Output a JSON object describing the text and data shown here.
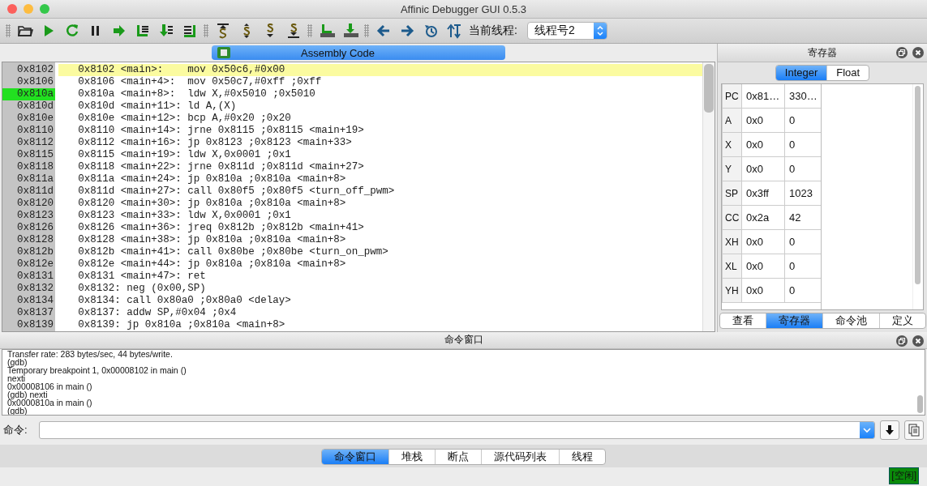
{
  "window": {
    "title": "Affinic Debugger GUI 0.5.3"
  },
  "toolbar": {
    "thread_label": "当前线程:",
    "thread_value": "线程号2"
  },
  "assembly": {
    "title": "Assembly Code",
    "rows": [
      {
        "address": "0x8102",
        "code": "0x8102 <main>:    mov 0x50c6,#0x00",
        "current": true,
        "marked": false
      },
      {
        "address": "0x8106",
        "code": "0x8106 <main+4>:  mov 0x50c7,#0xff ;0xff",
        "current": false,
        "marked": false
      },
      {
        "address": "0x810a",
        "code": "0x810a <main+8>:  ldw X,#0x5010 ;0x5010",
        "current": false,
        "marked": true
      },
      {
        "address": "0x810d",
        "code": "0x810d <main+11>: ld A,(X)",
        "current": false,
        "marked": false
      },
      {
        "address": "0x810e",
        "code": "0x810e <main+12>: bcp A,#0x20 ;0x20",
        "current": false,
        "marked": false
      },
      {
        "address": "0x8110",
        "code": "0x8110 <main+14>: jrne 0x8115 ;0x8115 <main+19>",
        "current": false,
        "marked": false
      },
      {
        "address": "0x8112",
        "code": "0x8112 <main+16>: jp 0x8123 ;0x8123 <main+33>",
        "current": false,
        "marked": false
      },
      {
        "address": "0x8115",
        "code": "0x8115 <main+19>: ldw X,0x0001 ;0x1",
        "current": false,
        "marked": false
      },
      {
        "address": "0x8118",
        "code": "0x8118 <main+22>: jrne 0x811d ;0x811d <main+27>",
        "current": false,
        "marked": false
      },
      {
        "address": "0x811a",
        "code": "0x811a <main+24>: jp 0x810a ;0x810a <main+8>",
        "current": false,
        "marked": false
      },
      {
        "address": "0x811d",
        "code": "0x811d <main+27>: call 0x80f5 ;0x80f5 <turn_off_pwm>",
        "current": false,
        "marked": false
      },
      {
        "address": "0x8120",
        "code": "0x8120 <main+30>: jp 0x810a ;0x810a <main+8>",
        "current": false,
        "marked": false
      },
      {
        "address": "0x8123",
        "code": "0x8123 <main+33>: ldw X,0x0001 ;0x1",
        "current": false,
        "marked": false
      },
      {
        "address": "0x8126",
        "code": "0x8126 <main+36>: jreq 0x812b ;0x812b <main+41>",
        "current": false,
        "marked": false
      },
      {
        "address": "0x8128",
        "code": "0x8128 <main+38>: jp 0x810a ;0x810a <main+8>",
        "current": false,
        "marked": false
      },
      {
        "address": "0x812b",
        "code": "0x812b <main+41>: call 0x80be ;0x80be <turn_on_pwm>",
        "current": false,
        "marked": false
      },
      {
        "address": "0x812e",
        "code": "0x812e <main+44>: jp 0x810a ;0x810a <main+8>",
        "current": false,
        "marked": false
      },
      {
        "address": "0x8131",
        "code": "0x8131 <main+47>: ret",
        "current": false,
        "marked": false
      },
      {
        "address": "0x8132",
        "code": "0x8132: neg (0x00,SP)",
        "current": false,
        "marked": false
      },
      {
        "address": "0x8134",
        "code": "0x8134: call 0x80a0 ;0x80a0 <delay>",
        "current": false,
        "marked": false
      },
      {
        "address": "0x8137",
        "code": "0x8137: addw SP,#0x04 ;0x4",
        "current": false,
        "marked": false
      },
      {
        "address": "0x8139",
        "code": "0x8139: jp 0x810a ;0x810a <main+8>",
        "current": false,
        "marked": false
      }
    ]
  },
  "registers": {
    "title": "寄存器",
    "tabs": [
      {
        "label": "Integer",
        "selected": true
      },
      {
        "label": "Float",
        "selected": false
      }
    ],
    "rows": [
      {
        "name": "PC",
        "hex": "0x81…",
        "dec": "330…"
      },
      {
        "name": "A",
        "hex": "0x0",
        "dec": "0"
      },
      {
        "name": "X",
        "hex": "0x0",
        "dec": "0"
      },
      {
        "name": "Y",
        "hex": "0x0",
        "dec": "0"
      },
      {
        "name": "SP",
        "hex": "0x3ff",
        "dec": "1023"
      },
      {
        "name": "CC",
        "hex": "0x2a",
        "dec": "42"
      },
      {
        "name": "XH",
        "hex": "0x0",
        "dec": "0"
      },
      {
        "name": "XL",
        "hex": "0x0",
        "dec": "0"
      },
      {
        "name": "YH",
        "hex": "0x0",
        "dec": "0"
      }
    ],
    "bottom_tabs": [
      {
        "label": "查看",
        "selected": false
      },
      {
        "label": "寄存器",
        "selected": true
      },
      {
        "label": "命令池",
        "selected": false
      },
      {
        "label": "定义",
        "selected": false
      }
    ]
  },
  "command_window": {
    "title": "命令窗口",
    "output": [
      "Transfer rate: 283 bytes/sec, 44 bytes/write.",
      "(gdb)",
      "Temporary breakpoint 1, 0x00008102 in main ()",
      "nexti",
      "0x00008106 in main ()",
      "(gdb) nexti",
      "0x0000810a in main ()",
      "(gdb)"
    ],
    "command_label": "命令:",
    "tabs": [
      {
        "label": "命令窗口",
        "selected": true
      },
      {
        "label": "堆栈",
        "selected": false
      },
      {
        "label": "断点",
        "selected": false
      },
      {
        "label": "源代码列表",
        "selected": false
      },
      {
        "label": "线程",
        "selected": false
      }
    ]
  },
  "status_bar": {
    "status": "[空闲]"
  }
}
